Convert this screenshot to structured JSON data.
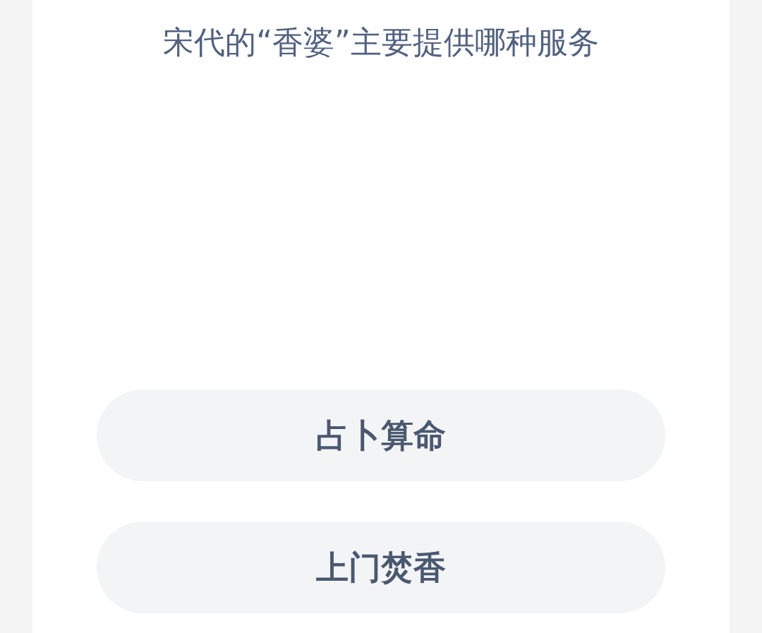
{
  "question": "宋代的“香婆”主要提供哪种服务",
  "options": [
    {
      "label": "占卜算命"
    },
    {
      "label": "上门焚香"
    }
  ]
}
